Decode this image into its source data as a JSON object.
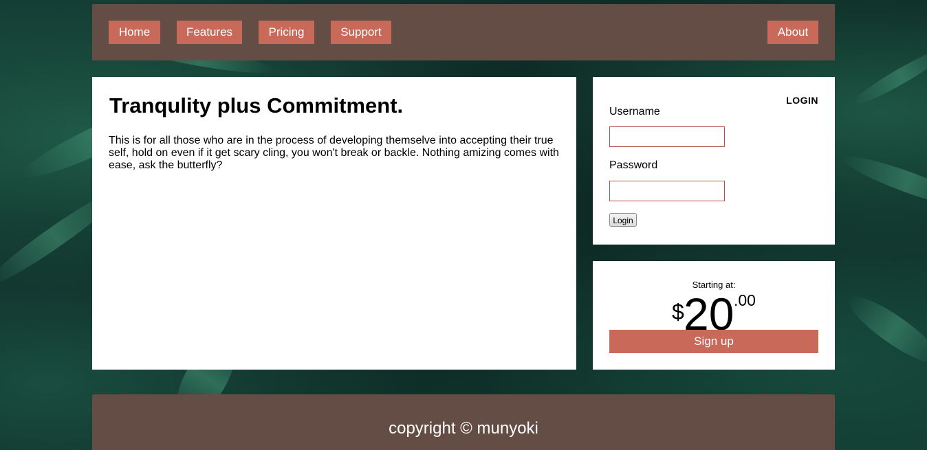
{
  "nav": {
    "items": [
      {
        "label": "Home"
      },
      {
        "label": "Features"
      },
      {
        "label": "Pricing"
      },
      {
        "label": "Support"
      },
      {
        "label": "About"
      }
    ]
  },
  "main": {
    "title": "Tranqulity plus Commitment.",
    "body": "This is for all those who are in the process of developing themselve into accepting their true self, hold on even if it get scary cling, you won't break or backle. Nothing amizing comes with ease, ask the butterfly?"
  },
  "login": {
    "title": "LOGIN",
    "username_label": "Username",
    "username_value": "",
    "password_label": "Password",
    "password_value": "",
    "button_label": "Login"
  },
  "pricing": {
    "starting_label": "Starting at:",
    "currency": "$",
    "amount": "20",
    "cents": ".00",
    "signup_label": "Sign up"
  },
  "footer": {
    "text": "copyright © munyoki"
  },
  "colors": {
    "bar_brown": "#644d45",
    "accent": "#c8695a",
    "input_border": "#b5514a"
  }
}
